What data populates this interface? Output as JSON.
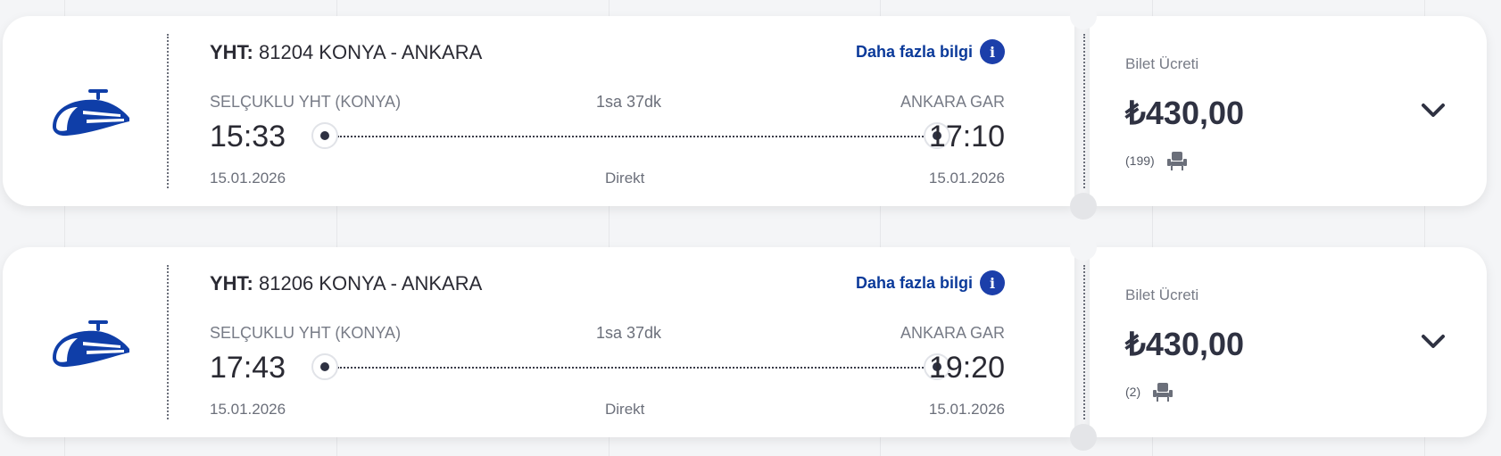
{
  "journeys": [
    {
      "train_type": "YHT:",
      "route_label": "81204 KONYA - ANKARA",
      "more_info_label": "Daha fazla bilgi",
      "info_icon": "info-icon",
      "departure_station": "SELÇUKLU YHT (KONYA)",
      "arrival_station": "ANKARA GAR",
      "duration": "1sa 37dk",
      "departure_time": "15:33",
      "arrival_time": "17:10",
      "departure_date": "15.01.2026",
      "arrival_date": "15.01.2026",
      "connection": "Direkt",
      "fare_label": "Bilet Ücreti",
      "price": "₺430,00",
      "seats_available": "(199)"
    },
    {
      "train_type": "YHT:",
      "route_label": "81206 KONYA - ANKARA",
      "more_info_label": "Daha fazla bilgi",
      "info_icon": "info-icon",
      "departure_station": "SELÇUKLU YHT (KONYA)",
      "arrival_station": "ANKARA GAR",
      "duration": "1sa 37dk",
      "departure_time": "17:43",
      "arrival_time": "19:20",
      "departure_date": "15.01.2026",
      "arrival_date": "15.01.2026",
      "connection": "Direkt",
      "fare_label": "Bilet Ücreti",
      "price": "₺430,00",
      "seats_available": "(2)"
    }
  ],
  "icons": {
    "train": "high-speed-train-icon",
    "seat": "seat-icon",
    "expand": "chevron-down-icon",
    "info": "info-icon"
  },
  "colors": {
    "brand_blue": "#0b3a9a",
    "info_blue": "#1c3faa",
    "text_dark": "#2a2a33",
    "text_muted": "#777b86"
  }
}
